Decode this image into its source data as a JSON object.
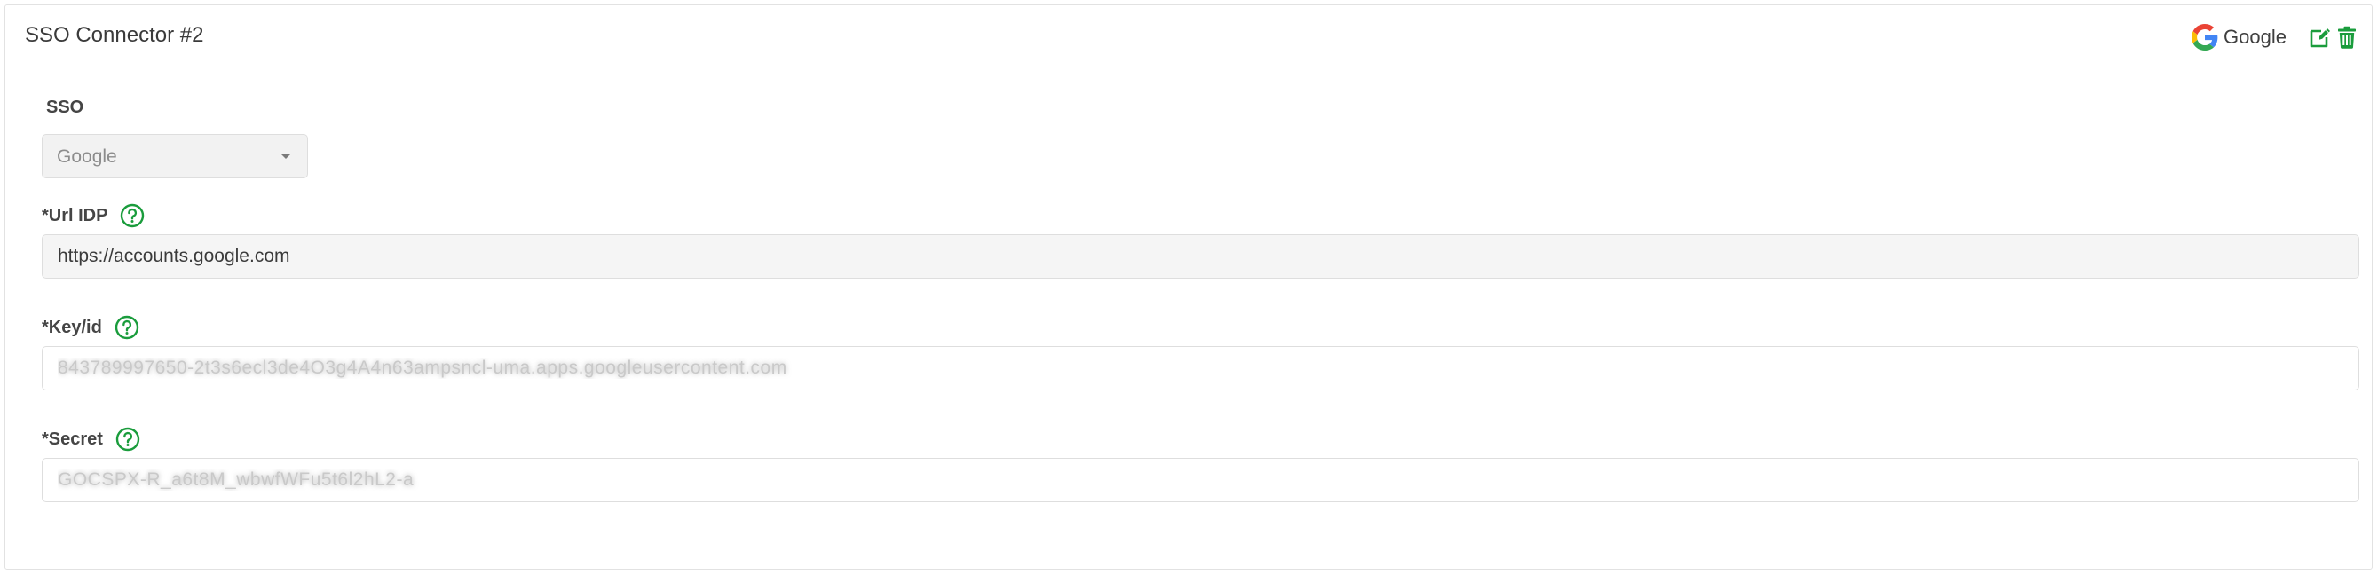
{
  "card": {
    "title": "SSO Connector #2",
    "provider": {
      "name": "Google",
      "icon": "google-g-logo"
    },
    "actions": {
      "edit_icon": "edit-icon",
      "delete_icon": "trash-icon"
    }
  },
  "form": {
    "sso": {
      "label": "SSO",
      "selected": "Google"
    },
    "url_idp": {
      "label": "*Url IDP",
      "value": "https://accounts.google.com"
    },
    "key_id": {
      "label": "*Key/id",
      "value": "843789997650-2t3s6ecl3de4O3g4A4n63ampsncl-uma.apps.googleusercontent.com"
    },
    "secret": {
      "label": "*Secret",
      "value": "GOCSPX-R_a6t8M_wbwfWFu5t6l2hL2-a"
    }
  },
  "colors": {
    "accent": "#1a9c3c",
    "border": "#e2e2e2",
    "readonly_bg": "#f5f5f5"
  }
}
